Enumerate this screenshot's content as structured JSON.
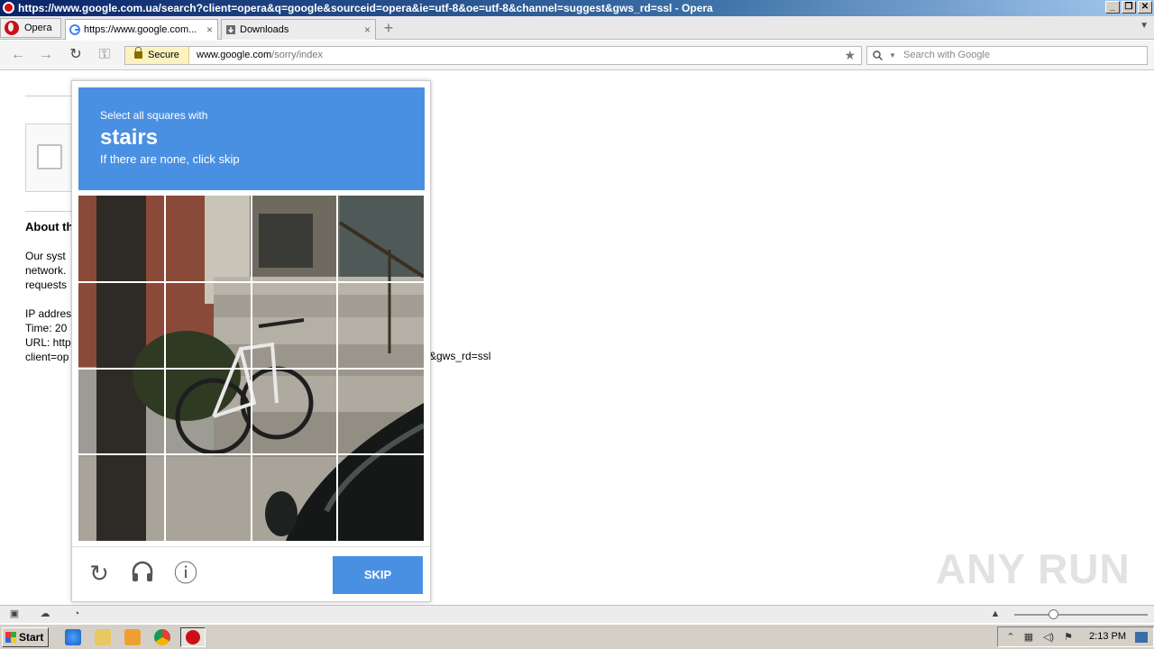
{
  "window": {
    "title": "https://www.google.com.ua/search?client=opera&q=google&sourceid=opera&ie=utf-8&oe=utf-8&channel=suggest&gws_rd=ssl - Opera",
    "buttons": [
      "_",
      "❐",
      "✕"
    ]
  },
  "tabs": {
    "menu_label": "Opera",
    "items": [
      {
        "label": "https://www.google.com...",
        "close": "×"
      },
      {
        "label": "Downloads",
        "close": "×"
      }
    ],
    "new_tab": "+",
    "menu_arrow": "▼"
  },
  "addressbar": {
    "back": "←",
    "forward": "→",
    "reload": "↻",
    "key": "⚿",
    "secure_label": "Secure",
    "url_domain": "www.google.com",
    "url_path": "/sorry/index",
    "star": "★",
    "search_placeholder": "Search with Google",
    "search_icon": "search-icon"
  },
  "page": {
    "about_heading": "About th",
    "para1": [
      "Our syst",
      "network.",
      "requests"
    ],
    "para2": [
      "IP addres",
      "Time: 20",
      "URL: http",
      "client=op"
    ],
    "tail_text": "&gws_rd=ssl"
  },
  "recaptcha": {
    "instruction_line1": "Select all squares with",
    "keyword": "stairs",
    "instruction_line3": "If there are none, click skip",
    "skip_label": "SKIP",
    "reload_icon": "↻",
    "audio_icon": "🎧",
    "info_icon": "ⓘ",
    "header_color": "#4a90e2"
  },
  "watermark": "ANY RUN",
  "statusbar": {
    "icons": [
      "panel-icon",
      "cloud-icon",
      "speed-dial-icon"
    ],
    "up_arrow": "▲",
    "zoom_level": 0.3
  },
  "taskbar": {
    "start_label": "Start",
    "clock": "2:13 PM"
  }
}
